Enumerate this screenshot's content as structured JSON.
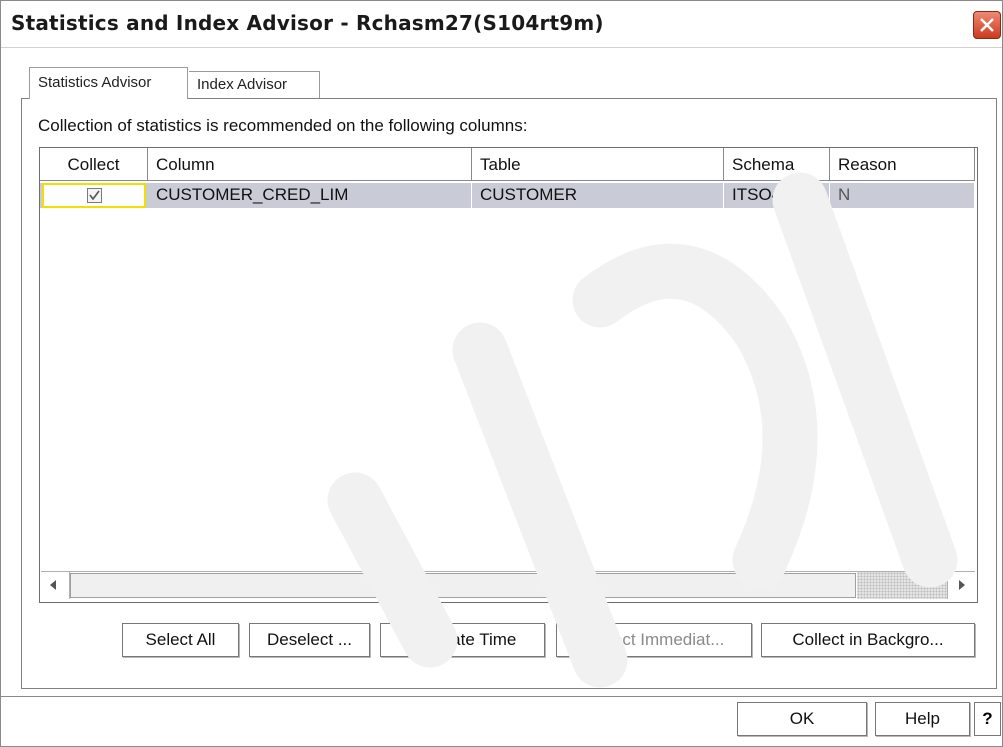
{
  "window": {
    "title": "Statistics and Index Advisor - Rchasm27(S104rt9m)"
  },
  "tabs": [
    {
      "label": "Statistics Advisor",
      "selected": true
    },
    {
      "label": "Index Advisor",
      "selected": false
    }
  ],
  "description": "Collection of statistics is recommended on the following columns:",
  "table": {
    "headers": [
      "Collect",
      "Column",
      "Table",
      "Schema",
      "Reason"
    ],
    "rows": [
      {
        "collect": true,
        "column": "CUSTOMER_CRED_LIM",
        "table": "CUSTOMER",
        "schema": "ITSO4710",
        "reason": "N"
      }
    ]
  },
  "buttons": {
    "select_all": "Select All",
    "deselect": "Deselect ...",
    "estimate_time": "Estimate Time",
    "collect_immediately": "Collect Immediat...",
    "collect_background": "Collect in Backgro..."
  },
  "footer": {
    "ok": "OK",
    "help": "Help",
    "question": "?"
  },
  "colors": {
    "selected_row": "#c9ccd6",
    "focus_border": "#efe000",
    "close_button": "#cc3a1e"
  },
  "icons": {
    "close": "close-icon",
    "checkbox": "checkmark-icon",
    "scroll_left": "chevron-left-icon",
    "scroll_right": "chevron-right-icon"
  }
}
